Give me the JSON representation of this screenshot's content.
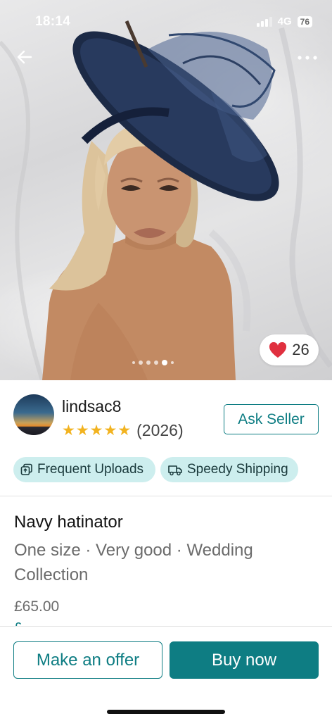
{
  "status_bar": {
    "time": "18:14",
    "network": "4G",
    "battery": "76"
  },
  "header": {
    "back_icon": "arrow-left-icon",
    "more_icon": "more-horizontal-icon"
  },
  "photo": {
    "carousel_count": 6,
    "carousel_active": 5,
    "like_count": "26"
  },
  "seller": {
    "username": "lindsac8",
    "rating_stars": 5,
    "review_count": "(2026)",
    "ask_seller_label": "Ask Seller",
    "badges": [
      {
        "icon": "uploads-icon",
        "label": "Frequent Uploads"
      },
      {
        "icon": "truck-icon",
        "label": "Speedy Shipping"
      }
    ]
  },
  "item": {
    "title": "Navy hatinator",
    "meta": "One size · Very good · Wedding Collection",
    "price": "£65.00"
  },
  "actions": {
    "offer_label": "Make an offer",
    "buy_label": "Buy now"
  },
  "colors": {
    "accent": "#0e7d83",
    "badge_bg": "#cdeeee",
    "star": "#f2b320",
    "heart": "#e0303f"
  }
}
